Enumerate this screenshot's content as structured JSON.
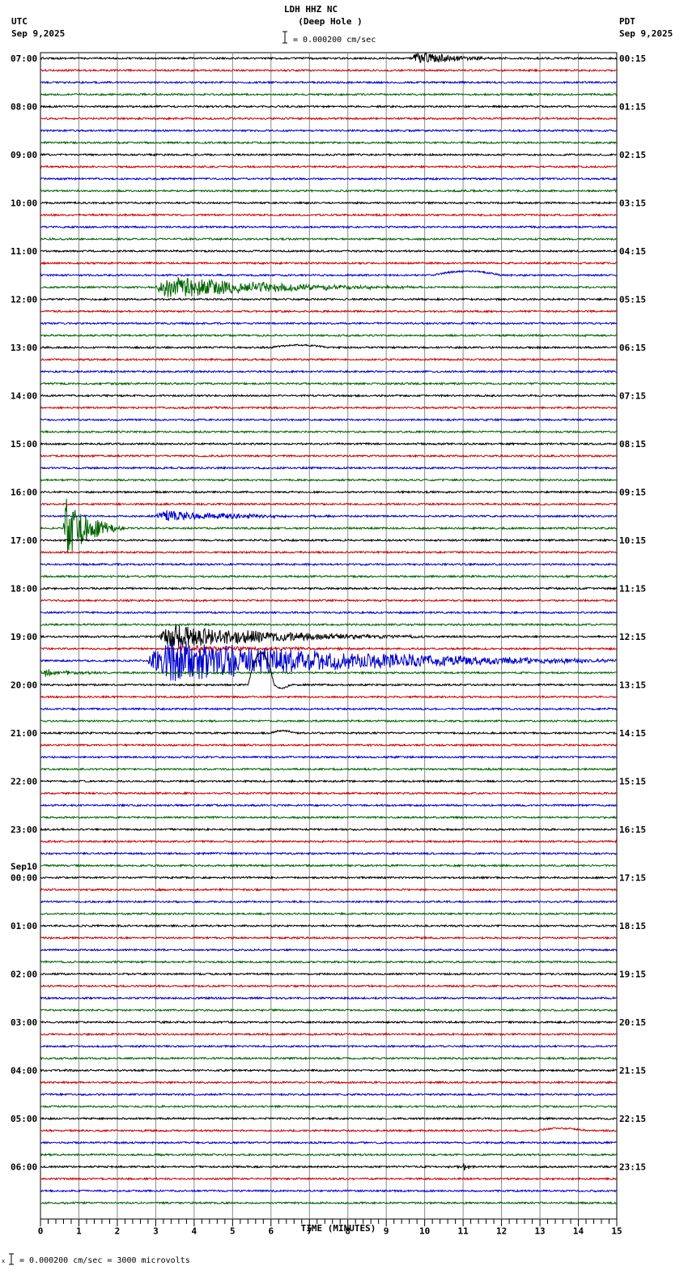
{
  "header": {
    "title": "LDH HHZ NC",
    "subtitle": "(Deep Hole )",
    "left_tz": "UTC",
    "left_date": "Sep 9,2025",
    "right_tz": "PDT",
    "right_date": "Sep 9,2025",
    "scale_text": "= 0.000200 cm/sec"
  },
  "footer": {
    "scale_text": "= 0.000200 cm/sec =    3000 microvolts"
  },
  "chart_data": {
    "type": "line",
    "title": "LDH HHZ NC (Deep Hole )",
    "xlabel": "TIME (MINUTES)",
    "xlim": [
      0,
      15
    ],
    "xticks": [
      "0",
      "1",
      "2",
      "3",
      "4",
      "5",
      "6",
      "7",
      "8",
      "9",
      "10",
      "11",
      "12",
      "13",
      "14",
      "15"
    ],
    "traces_per_hour": 4,
    "trace_colors": [
      "#000000",
      "#cc0000",
      "#0000cc",
      "#006400"
    ],
    "left_labels": [
      "07:00",
      "08:00",
      "09:00",
      "10:00",
      "11:00",
      "12:00",
      "13:00",
      "14:00",
      "15:00",
      "16:00",
      "17:00",
      "18:00",
      "19:00",
      "20:00",
      "21:00",
      "22:00",
      "23:00",
      "00:00",
      "01:00",
      "02:00",
      "03:00",
      "04:00",
      "05:00",
      "06:00"
    ],
    "left_date_change": {
      "hour_index": 17,
      "label": "Sep10"
    },
    "right_labels": [
      "00:15",
      "01:15",
      "02:15",
      "03:15",
      "04:15",
      "05:15",
      "06:15",
      "07:15",
      "08:15",
      "09:15",
      "10:15",
      "11:15",
      "12:15",
      "13:15",
      "14:15",
      "15:15",
      "16:15",
      "17:15",
      "18:15",
      "19:15",
      "20:15",
      "21:15",
      "22:15",
      "23:15"
    ],
    "events": [
      {
        "trace": 0,
        "start_min": 9.7,
        "end_min": 12.2,
        "amplitude": 8,
        "kind": "burst"
      },
      {
        "trace": 18,
        "start_min": 10.2,
        "end_min": 12.0,
        "amplitude": 5,
        "kind": "bump"
      },
      {
        "trace": 19,
        "start_min": 3.0,
        "end_min": 10.0,
        "amplitude": 12,
        "kind": "burst"
      },
      {
        "trace": 24,
        "start_min": 6.0,
        "end_min": 7.5,
        "amplitude": 3,
        "kind": "bump"
      },
      {
        "trace": 38,
        "start_min": 3.0,
        "end_min": 8.0,
        "amplitude": 6,
        "kind": "burst"
      },
      {
        "trace": 39,
        "start_min": 0.6,
        "end_min": 2.2,
        "amplitude": 35,
        "kind": "burst"
      },
      {
        "trace": 48,
        "start_min": 3.1,
        "end_min": 10.0,
        "amplitude": 14,
        "kind": "burst"
      },
      {
        "trace": 49,
        "start_min": 3.5,
        "end_min": 9.0,
        "amplitude": 4,
        "kind": "burst"
      },
      {
        "trace": 50,
        "start_min": 2.8,
        "end_min": 15.0,
        "amplitude": 25,
        "kind": "burst"
      },
      {
        "trace": 51,
        "start_min": 0.0,
        "end_min": 2.0,
        "amplitude": 4,
        "kind": "burst"
      },
      {
        "trace": 52,
        "start_min": 5.4,
        "end_min": 6.5,
        "amplitude": 40,
        "kind": "pulse"
      },
      {
        "trace": 56,
        "start_min": 6.0,
        "end_min": 6.6,
        "amplitude": 3,
        "kind": "bump"
      },
      {
        "trace": 89,
        "start_min": 12.9,
        "end_min": 14.2,
        "amplitude": 3,
        "kind": "bump"
      },
      {
        "trace": 92,
        "start_min": 11.0,
        "end_min": 11.4,
        "amplitude": 4,
        "kind": "burst"
      }
    ]
  }
}
